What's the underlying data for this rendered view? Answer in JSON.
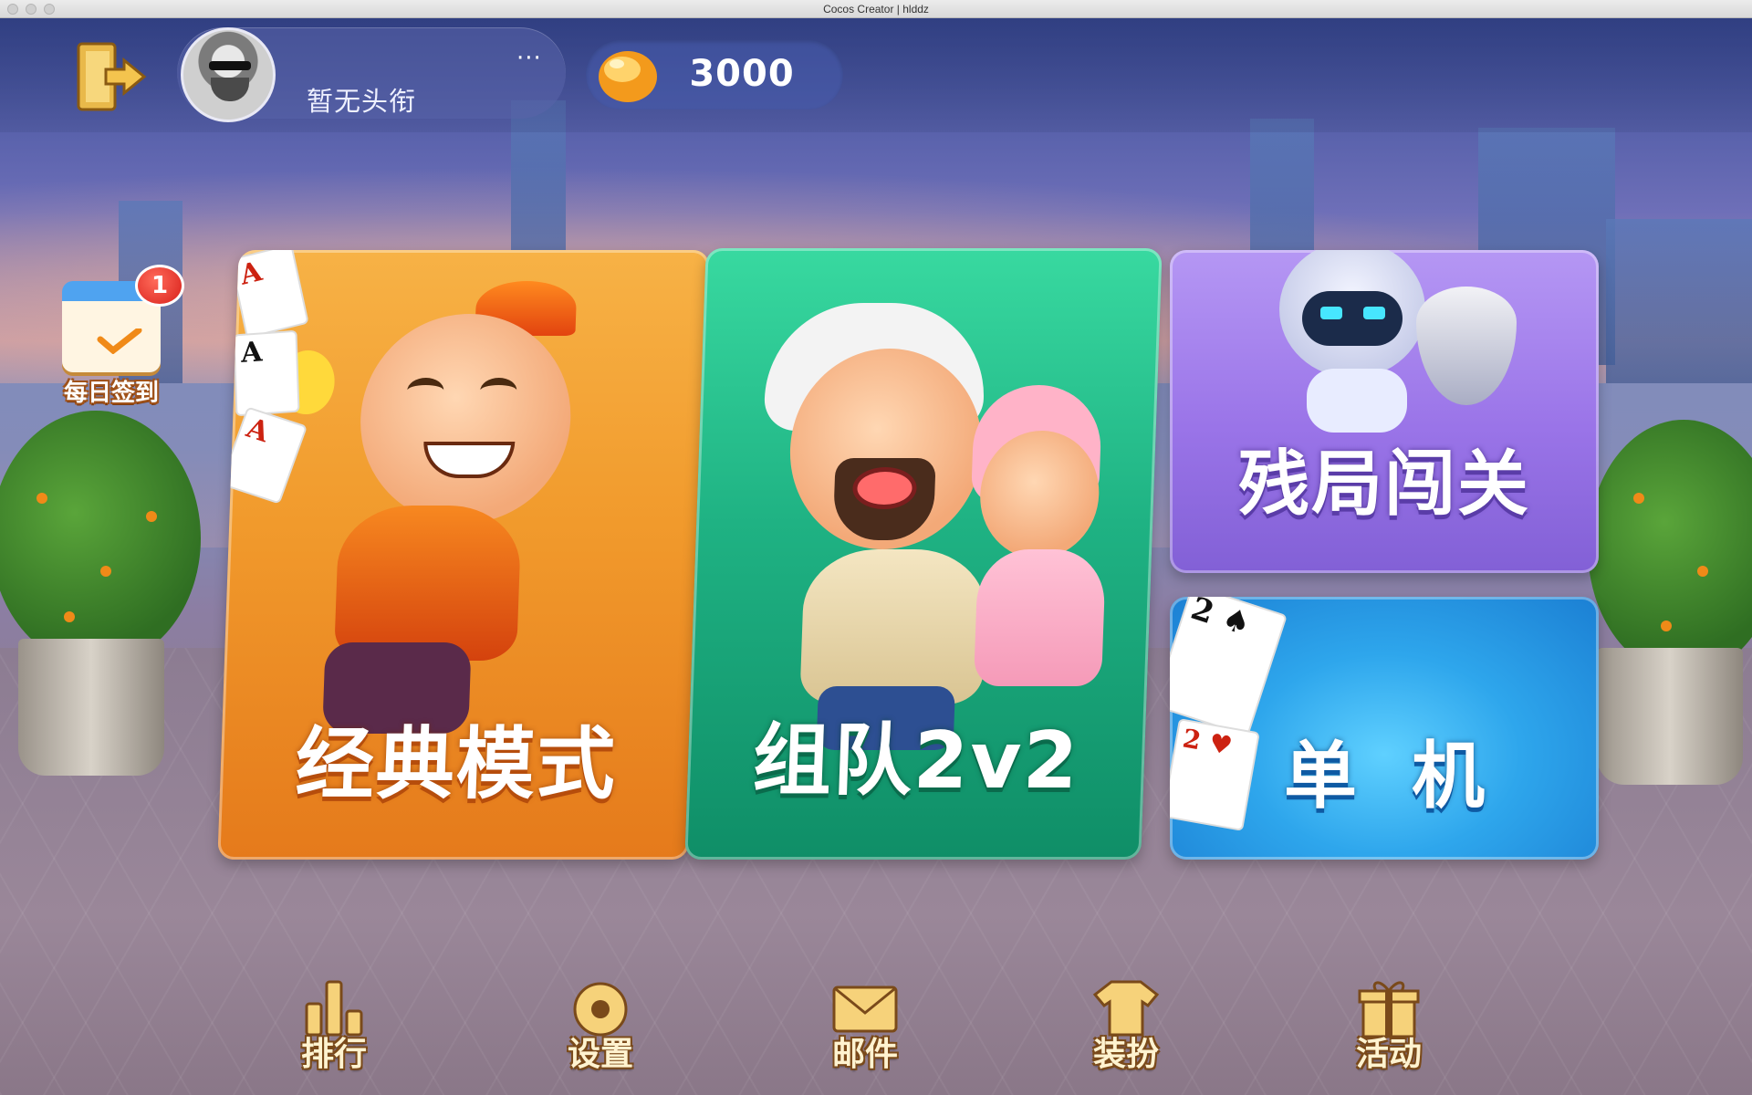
{
  "window": {
    "title": "Cocos Creator | hlddz"
  },
  "player": {
    "title": "暂无头衔",
    "more_label": "···",
    "beans": "3000"
  },
  "daily_checkin": {
    "label": "每日签到",
    "badge_count": "1"
  },
  "modes": {
    "classic": {
      "label": "经典模式",
      "color": "#f19a2c"
    },
    "team": {
      "label": "组队2v2",
      "color": "#1fb283"
    },
    "challenge": {
      "label": "残局闯关",
      "color": "#9a74e8"
    },
    "single": {
      "label": "单机",
      "color": "#2ea6ec"
    }
  },
  "bottom_nav": {
    "items": [
      {
        "label": "排行",
        "icon": "leaderboard-icon"
      },
      {
        "label": "设置",
        "icon": "gear-icon"
      },
      {
        "label": "邮件",
        "icon": "mail-icon"
      },
      {
        "label": "装扮",
        "icon": "shirt-icon"
      },
      {
        "label": "活动",
        "icon": "gift-icon"
      }
    ]
  },
  "icons": {
    "exit": "exit-door-icon",
    "bean": "bean-currency-icon",
    "calendar": "calendar-check-icon"
  }
}
